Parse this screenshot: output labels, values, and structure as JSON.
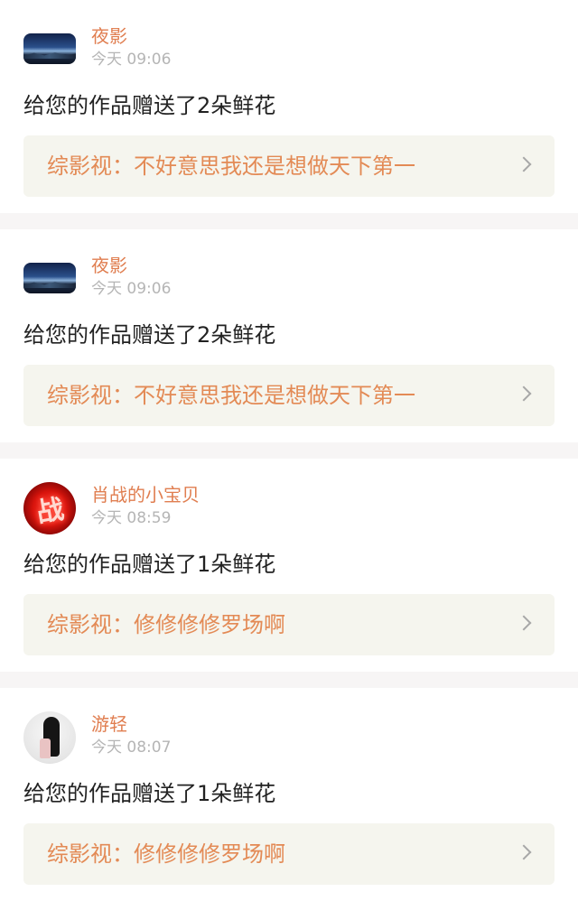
{
  "notifications": [
    {
      "user": "夜影",
      "avatar": "landscape-avatar",
      "time": "今天 09:06",
      "message": "给您的作品赠送了2朵鲜花",
      "reference": "综影视：不好意思我还是想做天下第一"
    },
    {
      "user": "夜影",
      "avatar": "landscape-avatar",
      "time": "今天 09:06",
      "message": "给您的作品赠送了2朵鲜花",
      "reference": "综影视：不好意思我还是想做天下第一"
    },
    {
      "user": "肖战的小宝贝",
      "avatar": "neon-avatar",
      "time": "今天 08:59",
      "message": "给您的作品赠送了1朵鲜花",
      "reference": "综影视：修修修修罗场啊"
    },
    {
      "user": "游轻",
      "avatar": "girl-avatar",
      "time": "今天 08:07",
      "message": "给您的作品赠送了1朵鲜花",
      "reference": "综影视：修修修修罗场啊"
    }
  ],
  "colors": {
    "accent": "#e77fa3",
    "username": "#e07e50",
    "reference_text": "#e38a55",
    "reference_bg": "#f5f5ee"
  }
}
